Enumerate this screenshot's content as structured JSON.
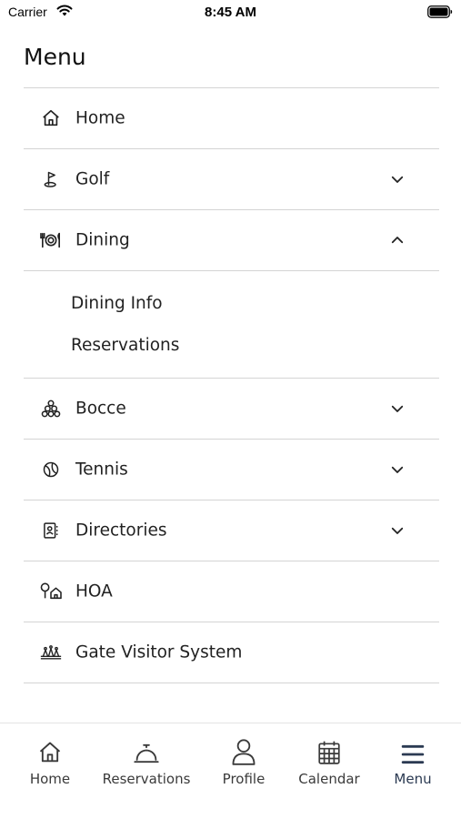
{
  "status_bar": {
    "carrier": "Carrier",
    "time": "8:45 AM"
  },
  "header": {
    "title": "Menu"
  },
  "menu": {
    "items": [
      {
        "label": "Home",
        "icon": "home-icon",
        "expandable": false
      },
      {
        "label": "Golf",
        "icon": "golf-icon",
        "expandable": true,
        "expanded": false
      },
      {
        "label": "Dining",
        "icon": "dining-icon",
        "expandable": true,
        "expanded": true,
        "subitems": [
          {
            "label": "Dining Info"
          },
          {
            "label": "Reservations"
          }
        ]
      },
      {
        "label": "Bocce",
        "icon": "bocce-icon",
        "expandable": true,
        "expanded": false
      },
      {
        "label": "Tennis",
        "icon": "tennis-icon",
        "expandable": true,
        "expanded": false
      },
      {
        "label": "Directories",
        "icon": "directories-icon",
        "expandable": true,
        "expanded": false
      },
      {
        "label": "HOA",
        "icon": "hoa-icon",
        "expandable": false
      },
      {
        "label": "Gate Visitor System",
        "icon": "gate-icon",
        "expandable": false
      }
    ]
  },
  "tabbar": {
    "tabs": [
      {
        "label": "Home",
        "icon": "home-icon",
        "active": false
      },
      {
        "label": "Reservations",
        "icon": "bell-icon",
        "active": false
      },
      {
        "label": "Profile",
        "icon": "person-icon",
        "active": false
      },
      {
        "label": "Calendar",
        "icon": "calendar-icon",
        "active": false
      },
      {
        "label": "Menu",
        "icon": "hamburger-icon",
        "active": true
      }
    ]
  },
  "colors": {
    "accent": "#2b3a52",
    "divider": "#d4d4d4",
    "text": "#222222"
  }
}
